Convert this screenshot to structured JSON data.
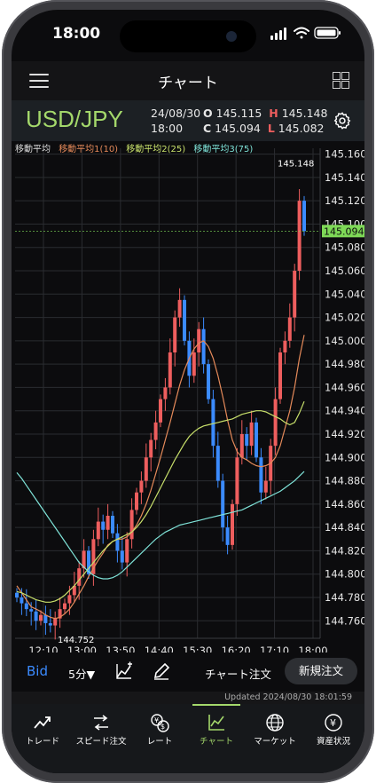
{
  "status_bar": {
    "time": "18:00"
  },
  "header": {
    "title": "チャート"
  },
  "info": {
    "pair": "USD/JPY",
    "date": "24/08/30",
    "time": "18:00",
    "open_label": "O",
    "open": "145.115",
    "high_label": "H",
    "high": "145.148",
    "close_label": "C",
    "close": "145.094",
    "low_label": "L",
    "low": "145.082"
  },
  "legend": {
    "title": "移動平均",
    "ma1": "移動平均1(10)",
    "ma2": "移動平均2(25)",
    "ma3": "移動平均3(75)"
  },
  "colors": {
    "accent": "#a4d86b",
    "up": "#ee5e5e",
    "down": "#3b8bff",
    "ma1": "#e58a5a",
    "ma2": "#c8e06b",
    "ma3": "#7fe3d8",
    "price_tag": "#7ed957"
  },
  "chart_data": {
    "type": "candlestick",
    "y_ticks": [
      "145.160",
      "145.140",
      "145.120",
      "145.100",
      "145.080",
      "145.060",
      "145.040",
      "145.020",
      "145.000",
      "144.980",
      "144.960",
      "144.940",
      "144.920",
      "144.900",
      "144.880",
      "144.860",
      "144.840",
      "144.820",
      "144.800",
      "144.780",
      "144.760"
    ],
    "ylim": [
      144.745,
      145.165
    ],
    "x_ticks": [
      "12:10",
      "13:00",
      "13:50",
      "14:40",
      "15:30",
      "16:20",
      "17:10",
      "18:00"
    ],
    "current_price": "145.094",
    "high_label": "145.148",
    "low_label": "144.752",
    "close_series": [
      144.78,
      144.775,
      144.77,
      144.768,
      144.76,
      144.765,
      144.758,
      144.756,
      144.762,
      144.77,
      144.775,
      144.782,
      144.79,
      144.805,
      144.82,
      144.8,
      144.83,
      144.845,
      144.838,
      144.85,
      144.835,
      144.82,
      144.81,
      144.83,
      144.855,
      144.87,
      144.88,
      144.9,
      144.915,
      144.93,
      144.95,
      144.96,
      144.99,
      145.02,
      145.035,
      145.0,
      144.97,
      144.99,
      145.01,
      144.98,
      144.95,
      144.91,
      144.88,
      144.84,
      144.825,
      144.86,
      144.9,
      144.92,
      144.91,
      144.93,
      144.9,
      144.87,
      144.88,
      144.91,
      144.95,
      144.99,
      145.0,
      145.02,
      145.06,
      145.12,
      145.094
    ],
    "ma_series": [
      {
        "name": "移動平均1(10)",
        "values": [
          144.79,
          144.784,
          144.778,
          144.772,
          144.77,
          144.768,
          144.765,
          144.763,
          144.762,
          144.763,
          144.766,
          144.77,
          144.776,
          144.783,
          144.79,
          144.798,
          144.805,
          144.812,
          144.818,
          144.825,
          144.828,
          144.83,
          144.83,
          144.832,
          144.836,
          144.842,
          144.85,
          144.86,
          144.872,
          144.886,
          144.9,
          144.915,
          144.93,
          144.946,
          144.962,
          144.975,
          144.985,
          144.993,
          144.998,
          145.0,
          144.995,
          144.985,
          144.97,
          144.952,
          144.932,
          144.915,
          144.905,
          144.9,
          144.898,
          144.895,
          144.893,
          144.892,
          144.893,
          144.895,
          144.9,
          144.91,
          144.925,
          144.94,
          144.96,
          144.985,
          145.005
        ]
      },
      {
        "name": "移動平均2(25)",
        "values": [
          144.785,
          144.784,
          144.782,
          144.78,
          144.778,
          144.777,
          144.776,
          144.776,
          144.777,
          144.779,
          144.782,
          144.786,
          144.79,
          144.795,
          144.8,
          144.805,
          144.81,
          144.815,
          144.82,
          144.824,
          144.828,
          144.83,
          144.832,
          144.834,
          144.836,
          144.84,
          144.845,
          144.851,
          144.858,
          144.866,
          144.874,
          144.882,
          144.89,
          144.898,
          144.905,
          144.912,
          144.918,
          144.922,
          144.925,
          144.927,
          144.928,
          144.929,
          144.93,
          144.931,
          144.932,
          144.933,
          144.935,
          144.937,
          144.938,
          144.939,
          144.94,
          144.94,
          144.939,
          144.937,
          144.935,
          144.933,
          144.93,
          144.928,
          144.93,
          144.938,
          144.948
        ]
      },
      {
        "name": "移動平均3(75)",
        "values": [
          144.887,
          144.882,
          144.876,
          144.87,
          144.864,
          144.858,
          144.852,
          144.846,
          144.84,
          144.834,
          144.828,
          144.822,
          144.816,
          144.81,
          144.806,
          144.802,
          144.799,
          144.797,
          144.796,
          144.796,
          144.797,
          144.799,
          144.802,
          144.806,
          144.81,
          144.814,
          144.818,
          144.822,
          144.826,
          144.83,
          144.833,
          144.836,
          144.838,
          144.84,
          144.842,
          144.843,
          144.844,
          144.845,
          144.846,
          144.847,
          144.848,
          144.849,
          144.85,
          144.851,
          144.852,
          144.853,
          144.854,
          144.855,
          144.857,
          144.859,
          144.861,
          144.863,
          144.865,
          144.867,
          144.869,
          144.871,
          144.874,
          144.877,
          144.88,
          144.884,
          144.888
        ]
      }
    ]
  },
  "toolbar": {
    "price_side": "Bid",
    "interval": "5分▼",
    "chart_order": "チャート注文",
    "new_order": "新規注文"
  },
  "updated": "Updated  2024/08/30 18:01:59",
  "tabs": [
    {
      "label": "トレード",
      "icon": "trend-up-icon"
    },
    {
      "label": "スピード注文",
      "icon": "speed-order-icon"
    },
    {
      "label": "レート",
      "icon": "rate-icon"
    },
    {
      "label": "チャート",
      "icon": "chart-icon"
    },
    {
      "label": "マーケット",
      "icon": "globe-icon"
    },
    {
      "label": "資産状況",
      "icon": "asset-icon"
    }
  ]
}
